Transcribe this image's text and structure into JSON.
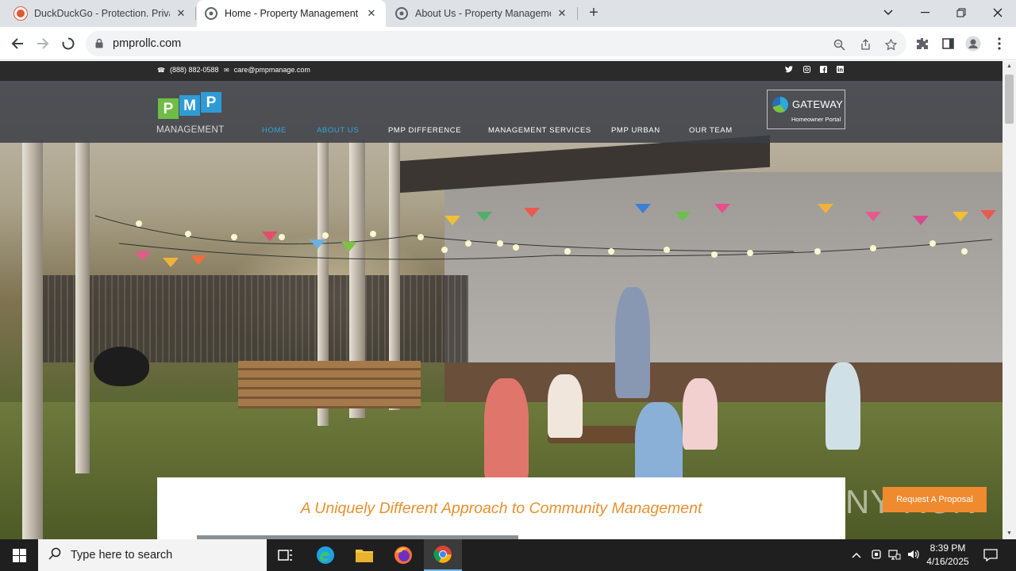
{
  "browser": {
    "tabs": [
      {
        "title": "DuckDuckGo - Protection. Privacy. Peace of mind.",
        "favicon": "duckduckgo-icon",
        "active": false
      },
      {
        "title": "Home - Property Management Professionals",
        "favicon": "pmp-icon",
        "active": true
      },
      {
        "title": "About Us - Property Management Professionals",
        "favicon": "pmp-icon",
        "active": false
      }
    ],
    "new_tab_label": "+",
    "url": "pmprollc.com"
  },
  "site": {
    "phone": "(888) 882-0588",
    "email": "care@pmpmanage.com",
    "social": [
      "twitter-icon",
      "instagram-icon",
      "facebook-icon",
      "linkedin-icon"
    ],
    "logo_letters": [
      "P",
      "M",
      "P"
    ],
    "logo_word": "MANAGEMENT",
    "nav": [
      {
        "label": "HOME",
        "active": true
      },
      {
        "label": "ABOUT US",
        "active": true
      },
      {
        "label": "PMP DIFFERENCE",
        "active": false
      },
      {
        "label": "MANAGEMENT SERVICES",
        "active": false
      },
      {
        "label": "PMP URBAN",
        "active": false
      },
      {
        "label": "OUR TEAM",
        "active": false
      }
    ],
    "gateway_title": "GATEWAY",
    "gateway_subtitle": "Homeowner Portal",
    "tagline": "A Uniquely Different Approach to Community Management",
    "proposal_button": "Request A Proposal",
    "watermark": "ANY RUN"
  },
  "taskbar": {
    "search_placeholder": "Type here to search",
    "time": "8:39 PM",
    "date": "4/16/2025"
  },
  "colors": {
    "accent_blue": "#32a8d8",
    "tagline_orange": "#e8902e",
    "proposal_orange": "#ef8a2f",
    "logo_green": "#6fbd45",
    "logo_blue": "#2f9bd6"
  }
}
